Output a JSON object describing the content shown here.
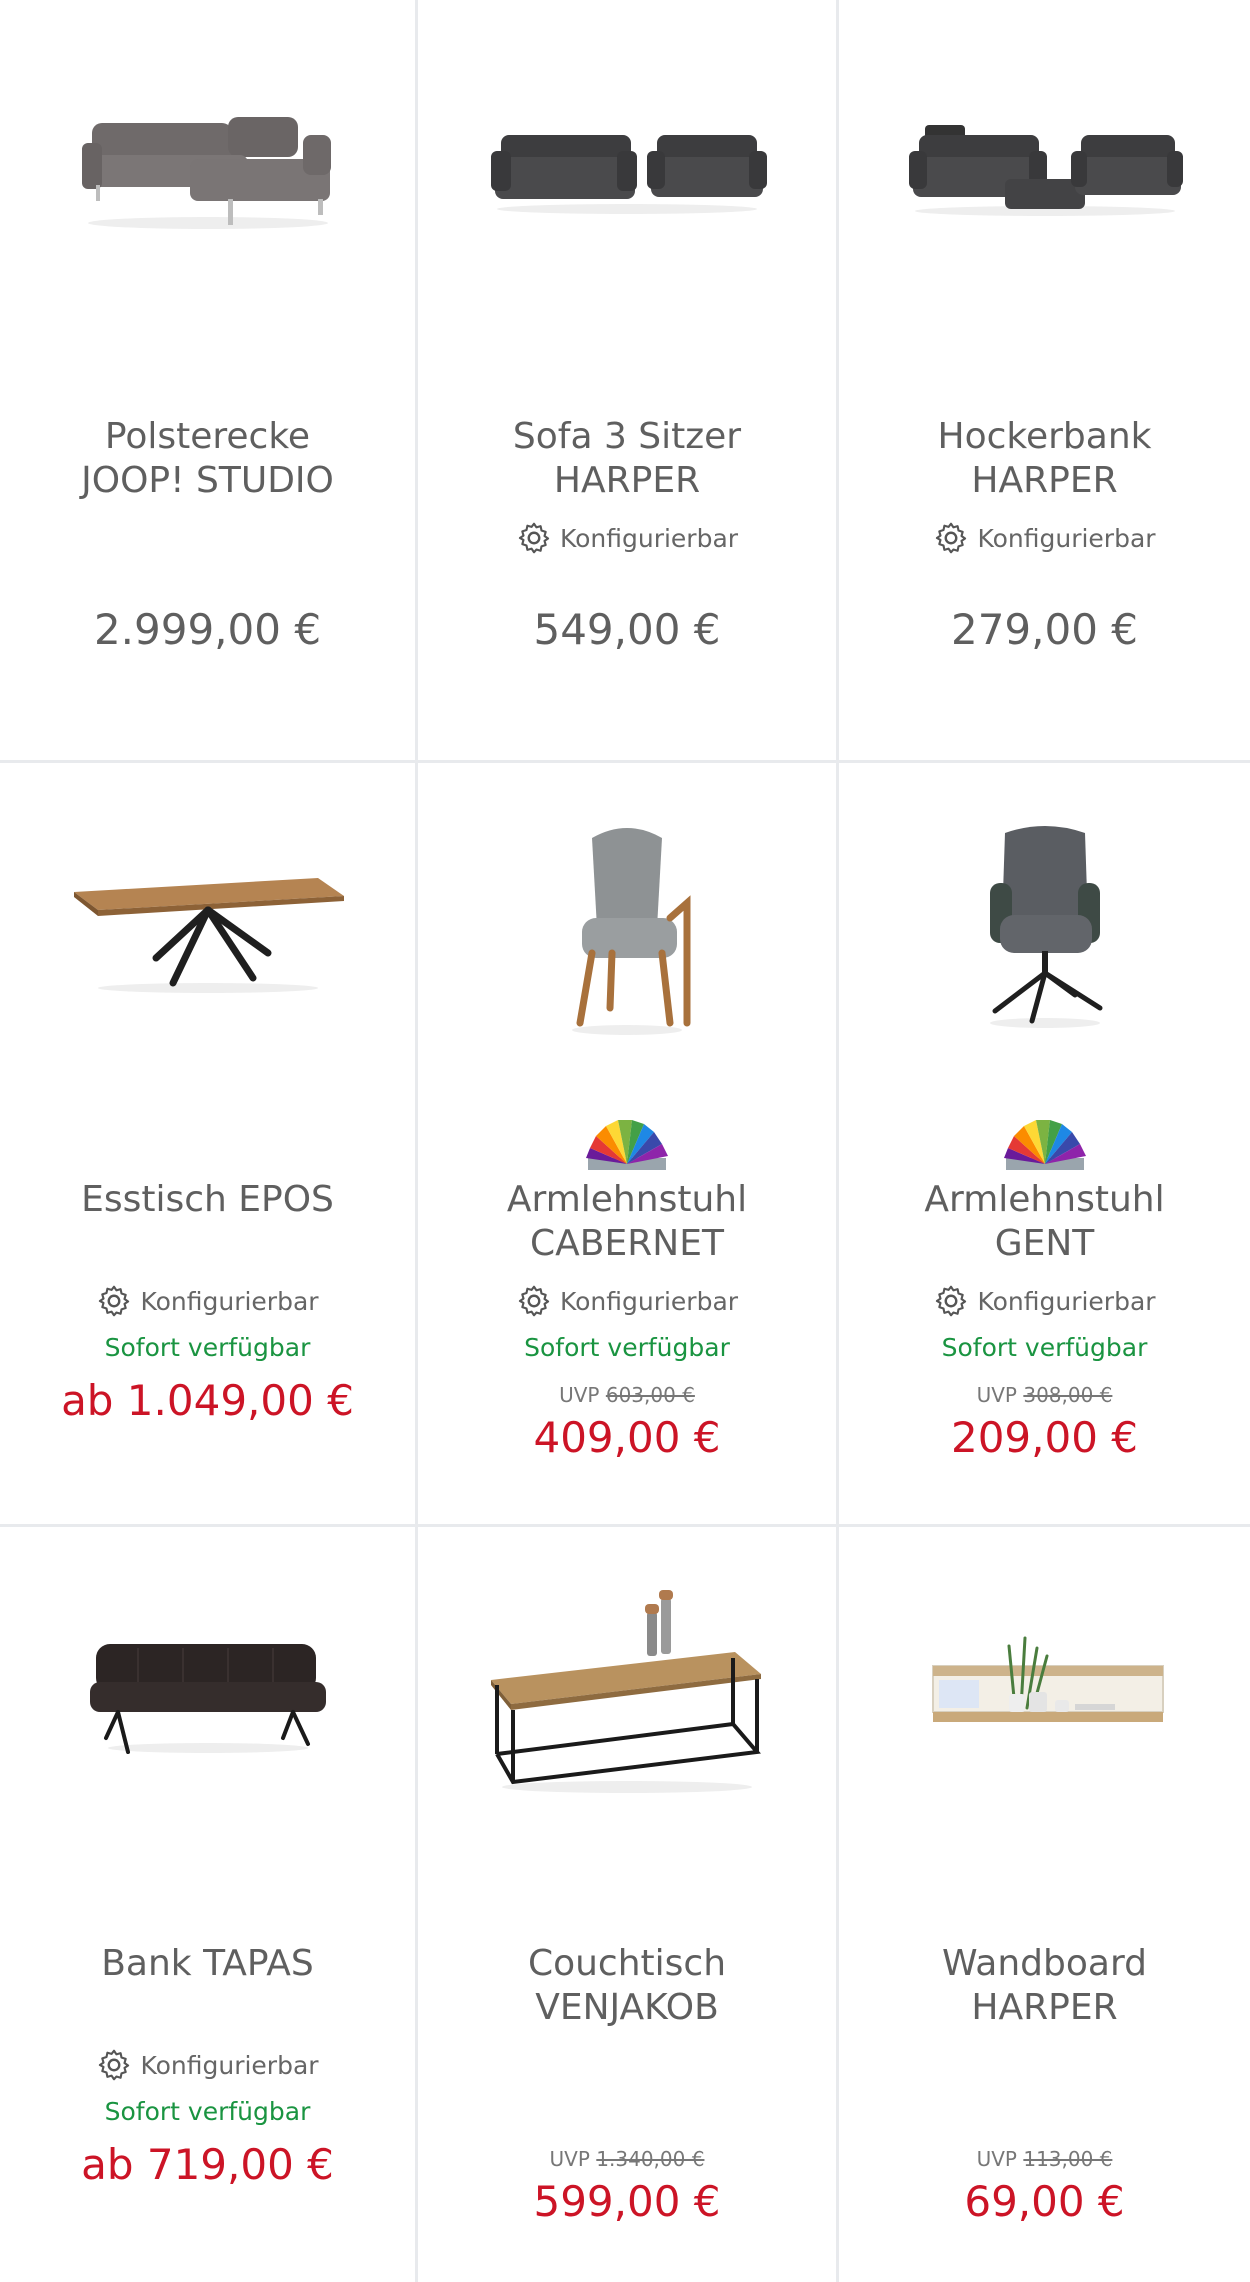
{
  "products": [
    {
      "id": "p1",
      "title": "Polsterecke\nJOOP! STUDIO",
      "configurable": false,
      "available": false,
      "uvp": null,
      "price": "2.999,00 €",
      "sale": false
    },
    {
      "id": "p2",
      "title": "Sofa 3 Sitzer\nHARPER",
      "configurable": true,
      "available": false,
      "uvp": null,
      "price": "549,00 €",
      "sale": false
    },
    {
      "id": "p3",
      "title": "Hockerbank\nHARPER",
      "configurable": true,
      "available": false,
      "uvp": null,
      "price": "279,00 €",
      "sale": false
    },
    {
      "id": "p4",
      "title": "Esstisch EPOS",
      "configurable": true,
      "available": true,
      "uvp": null,
      "price": "ab 1.049,00 €",
      "sale": true
    },
    {
      "id": "p5",
      "title": "Armlehnstuhl\nCABERNET",
      "configurable": true,
      "available": true,
      "uvp": "603,00 €",
      "price": "409,00 €",
      "sale": true,
      "color_swatch": true
    },
    {
      "id": "p6",
      "title": "Armlehnstuhl\nGENT",
      "configurable": true,
      "available": true,
      "uvp": "308,00 €",
      "price": "209,00 €",
      "sale": true,
      "color_swatch": true
    },
    {
      "id": "p7",
      "title": "Bank TAPAS",
      "configurable": true,
      "available": true,
      "uvp": null,
      "price": "ab 719,00 €",
      "sale": true
    },
    {
      "id": "p8",
      "title": "Couchtisch\nVENJAKOB",
      "configurable": false,
      "available": false,
      "uvp": "1.340,00 €",
      "price": "599,00 €",
      "sale": true
    },
    {
      "id": "p9",
      "title": "Wandboard\nHARPER",
      "configurable": false,
      "available": false,
      "uvp": "113,00 €",
      "price": "69,00 €",
      "sale": true
    }
  ],
  "labels": {
    "configurable": "Konfigurierbar",
    "available": "Sofort verfügbar",
    "uvp_prefix": "UVP"
  },
  "colors": {
    "sale_price": "#cc1426",
    "available": "#1a9441",
    "regular_price": "#5f5f5f",
    "divider": "#e8eaed"
  },
  "icons": {
    "configurable": "gear-icon",
    "color_variants": "color-fan-icon"
  }
}
